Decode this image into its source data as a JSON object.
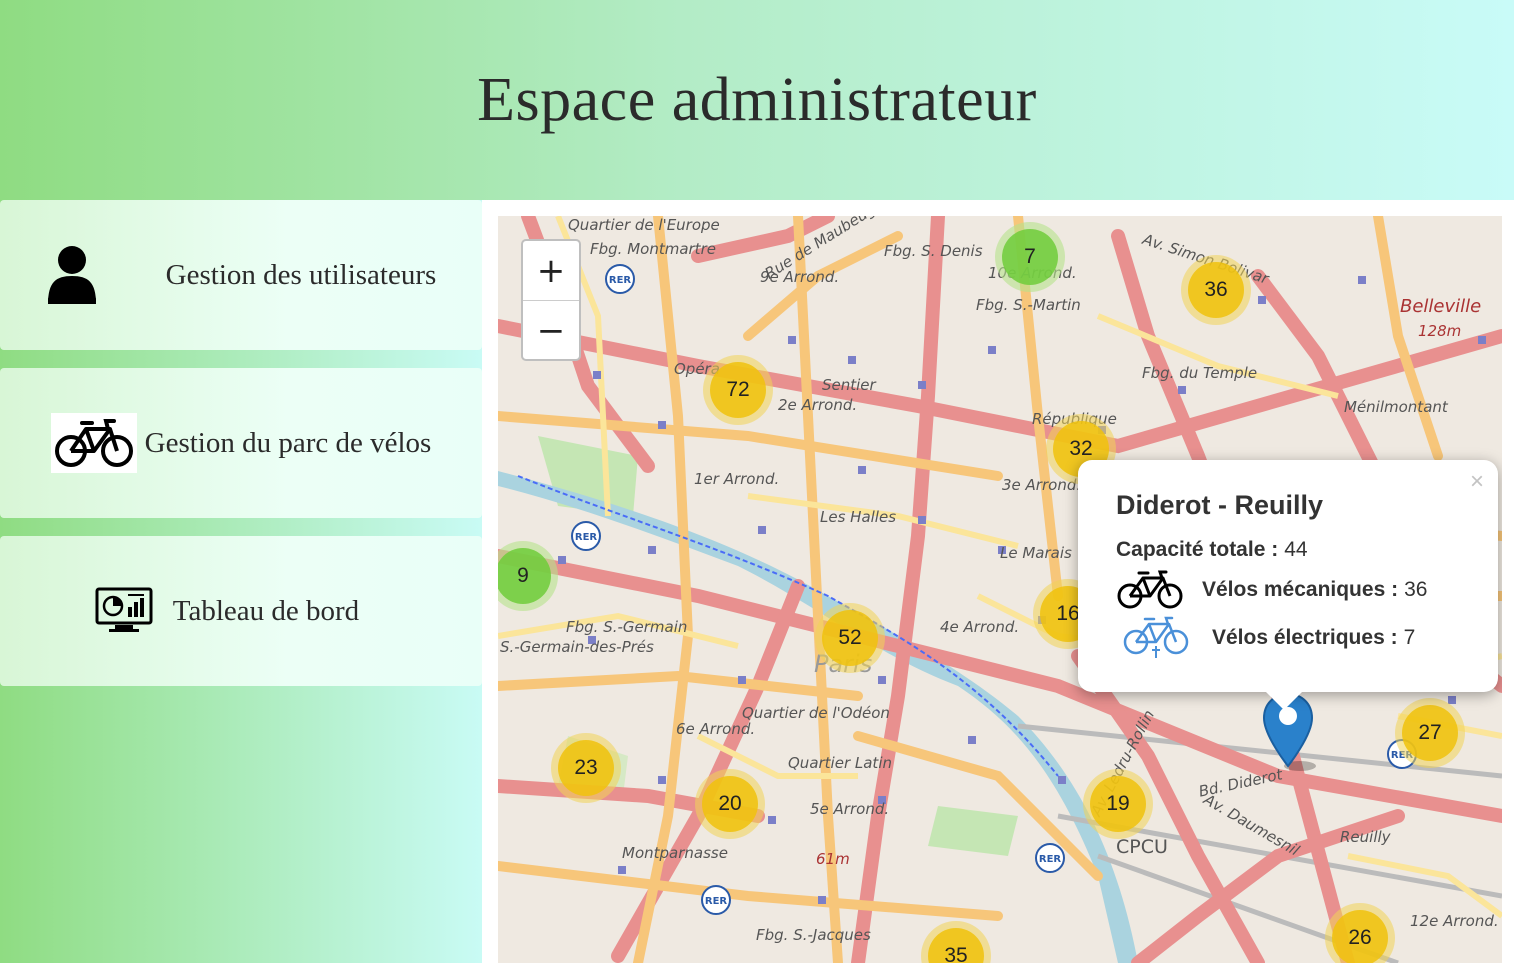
{
  "header": {
    "title": "Espace administrateur"
  },
  "sidebar": {
    "items": [
      {
        "label": "Gestion des utilisateurs",
        "icon": "user-icon"
      },
      {
        "label": "Gestion du parc de vélos",
        "icon": "bicycle-icon"
      },
      {
        "label": "Tableau de bord",
        "icon": "dashboard-icon"
      }
    ]
  },
  "map": {
    "zoom_in": "+",
    "zoom_out": "−",
    "clusters": [
      "7",
      "36",
      "72",
      "32",
      "9",
      "16",
      "52",
      "23",
      "20",
      "19",
      "27",
      "26",
      "35"
    ],
    "labels": [
      "Quartier de l'Europe",
      "Fbg. Montmartre",
      "9e Arrond.",
      "Fbg. S. Denis",
      "10e Arrond.",
      "Fbg. S.-Martin",
      "Belleville",
      "128m",
      "Opéra",
      "Sentier",
      "2e Arrond.",
      "Fbg. du Temple",
      "Ménilmontant",
      "République",
      "1er Arrond.",
      "Les Halles",
      "3e Arrond.",
      "Le Marais",
      "Fbg. S.-Germain",
      "S.-Germain-des-Prés",
      "Paris",
      "4e Arrond.",
      "Quartier de l'Odéon",
      "6e Arrond.",
      "Quartier Latin",
      "5e Arrond.",
      "61m",
      "Montparnasse",
      "CPCU",
      "Fbg. S.-Jacques",
      "Bd. Diderot",
      "Av. Daumesnil",
      "Reuilly",
      "12e Arrond.",
      "Av. Ledru-Rollin",
      "Av. Simon Bolivar",
      "Rue de Maubeuge"
    ],
    "popup": {
      "title": "Diderot - Reuilly",
      "close": "×",
      "capacity_label": "Capacité totale :",
      "capacity_value": "44",
      "mechanical_label": "Vélos mécaniques :",
      "mechanical_value": "36",
      "electric_label": "Vélos électriques :",
      "electric_value": "7"
    }
  },
  "colors": {
    "cluster_yellow": "#f0c20c",
    "cluster_green": "#6ecc39",
    "marker_blue": "#2a81cb",
    "electric_icon": "#4a90d9"
  }
}
